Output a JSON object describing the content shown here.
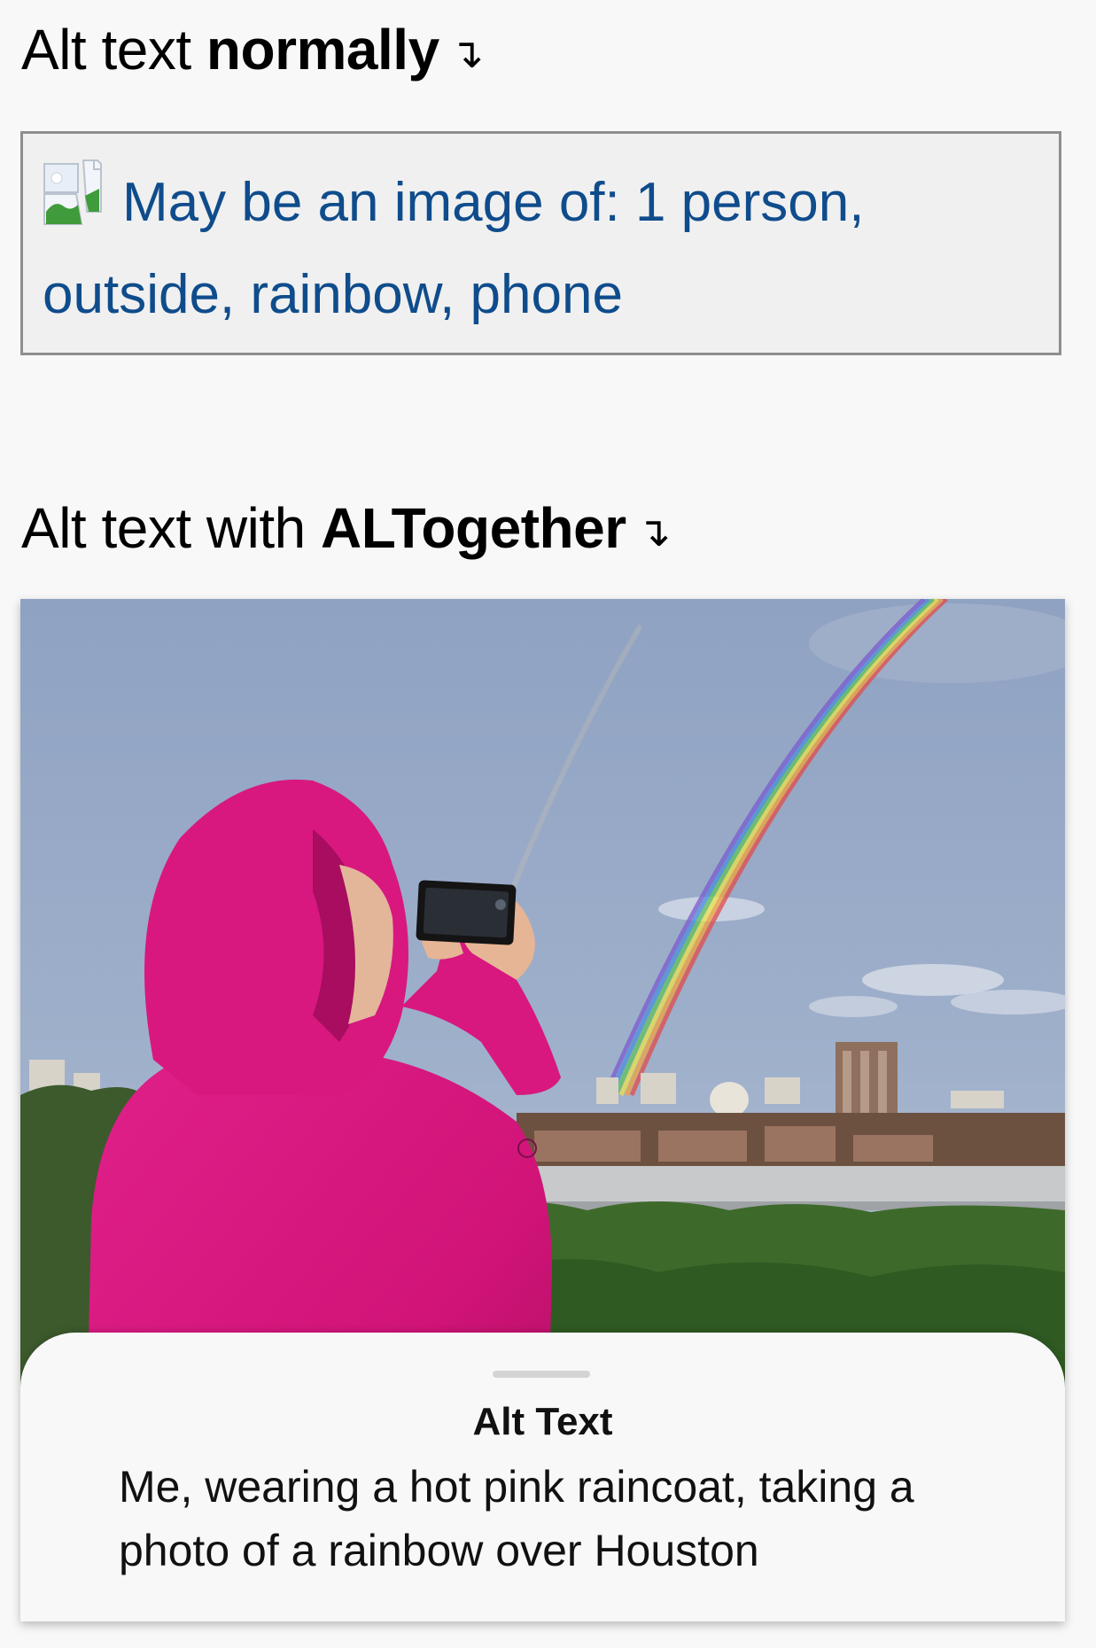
{
  "sections": {
    "normal": {
      "prefix": "Alt text ",
      "emphasis": "normally",
      "arrow": "↴"
    },
    "altogether": {
      "prefix": "Alt text with ",
      "emphasis": "ALTogether",
      "arrow": "↴"
    }
  },
  "broken_image": {
    "icon": "broken-image-icon",
    "alt_text": "May be an image of: 1 person, outside, rainbow, phone",
    "text_color": "#0f4c8c"
  },
  "photo": {
    "icon": "photo-of-person-in-pink-raincoat-photographing-rainbow"
  },
  "alt_sheet": {
    "title": "Alt Text",
    "body": "Me, wearing a hot pink raincoat, taking a photo of a rainbow over Houston"
  },
  "colors": {
    "background": "#f8f8f8",
    "raincoat": "#d4157a",
    "sky": "#9fb0c9",
    "link_blue": "#0f4c8c"
  }
}
